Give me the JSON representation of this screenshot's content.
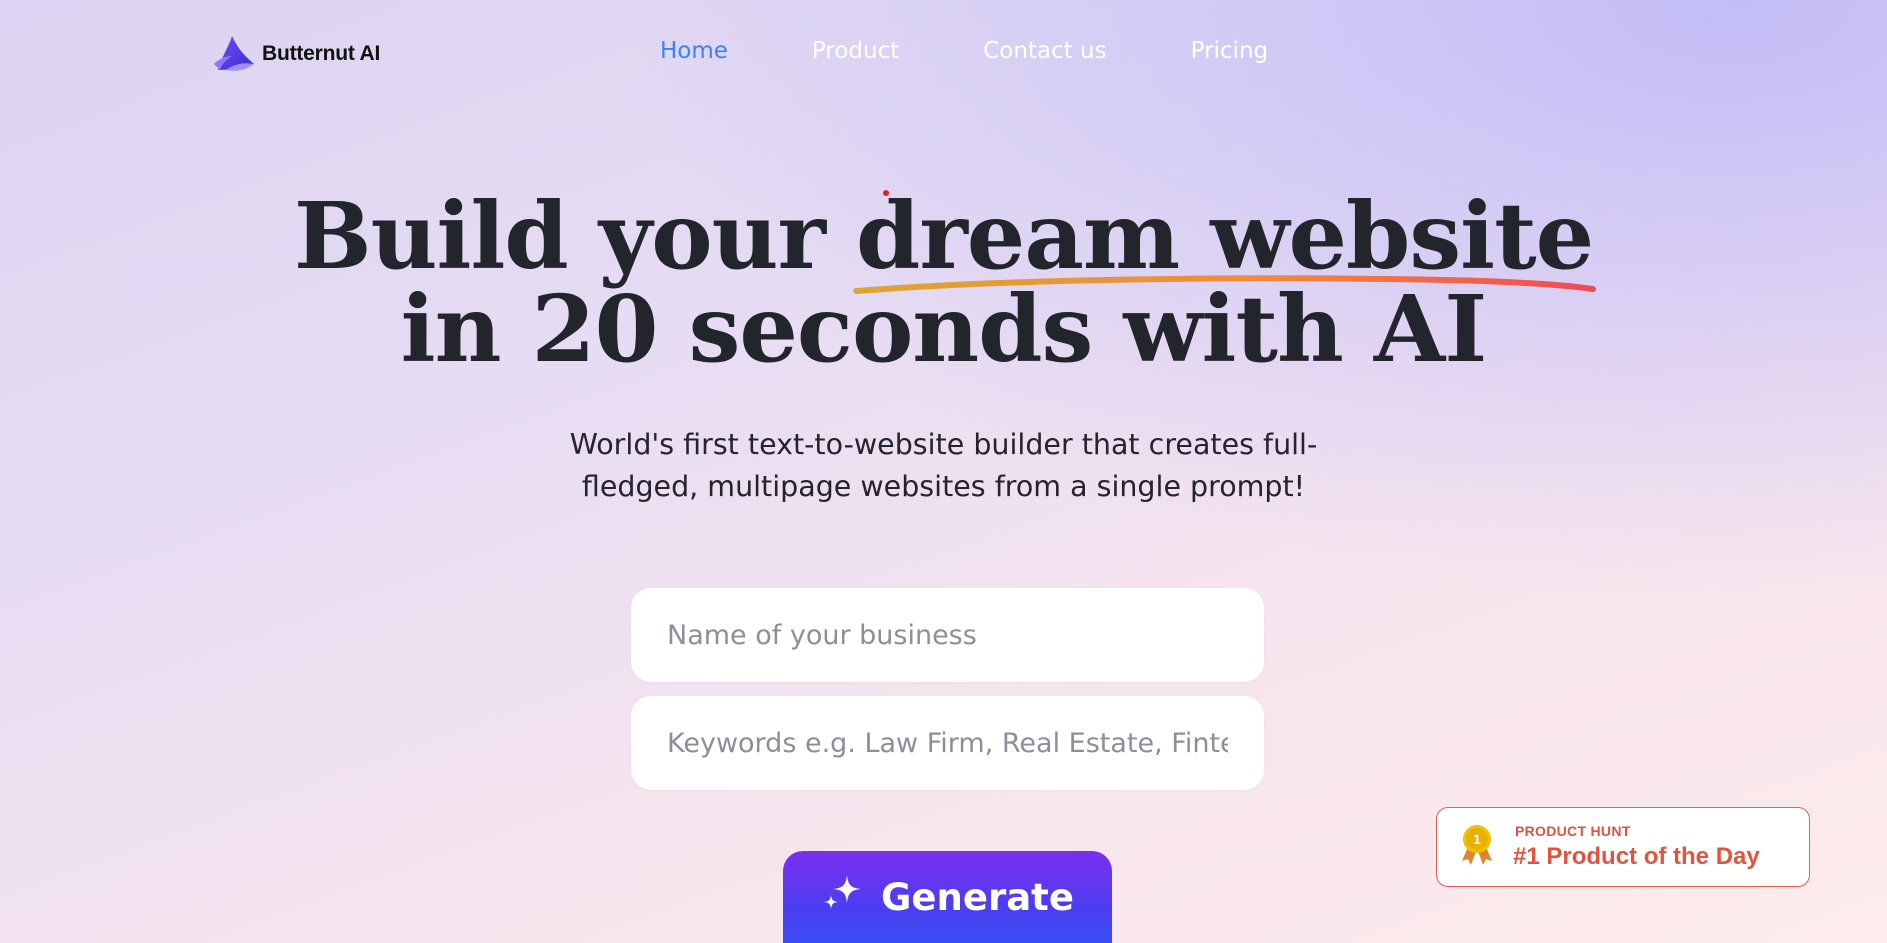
{
  "brand": {
    "name": "Butternut AI",
    "accent": "#5b3df0"
  },
  "nav": {
    "items": [
      {
        "label": "Home",
        "active": true
      },
      {
        "label": "Product",
        "active": false
      },
      {
        "label": "Contact us",
        "active": false
      },
      {
        "label": "Pricing",
        "active": false
      }
    ]
  },
  "hero": {
    "title_line1_start": "Build your ",
    "title_highlight": "dream website",
    "title_line2": "in 20 seconds with AI",
    "subtitle_line1": "World's first text-to-website builder that creates full-",
    "subtitle_line2": "fledged, multipage websites from a single prompt!"
  },
  "form": {
    "business_placeholder": "Name of your business",
    "keywords_placeholder": "Keywords e.g. Law Firm, Real Estate, Fintech S",
    "business_value": "",
    "keywords_value": ""
  },
  "generate": {
    "label": "Generate",
    "icon": "sparkles-icon"
  },
  "badge": {
    "kicker": "PRODUCT HUNT",
    "title": "#1 Product of the Day",
    "medal_number": "1",
    "color": "#e2543f"
  }
}
